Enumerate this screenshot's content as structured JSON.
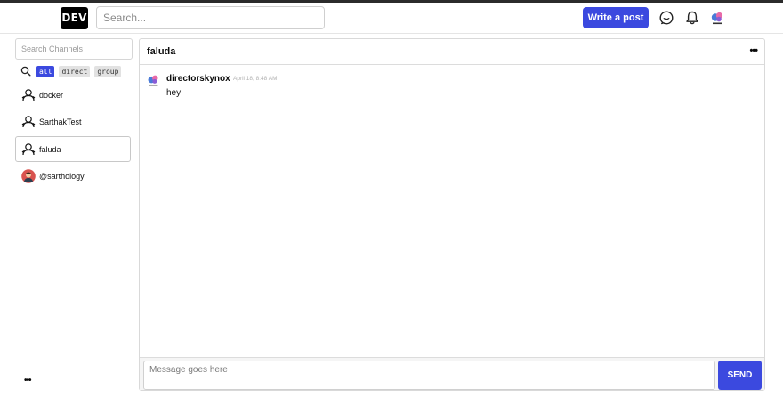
{
  "header": {
    "logo": "DEV",
    "search_placeholder": "Search...",
    "write_post_label": "Write a post",
    "icons": [
      "chat-icon",
      "bell-icon",
      "user-avatar"
    ]
  },
  "sidebar": {
    "search_placeholder": "Search Channels",
    "filters": [
      {
        "label": "all",
        "active": true
      },
      {
        "label": "direct",
        "active": false
      },
      {
        "label": "group",
        "active": false
      }
    ],
    "channels": [
      {
        "label": "docker",
        "icon": "group-channel-icon",
        "selected": false
      },
      {
        "label": "SarthakTest",
        "icon": "group-channel-icon",
        "selected": false
      },
      {
        "label": "faluda",
        "icon": "group-channel-icon",
        "selected": true
      },
      {
        "label": "@sarthology",
        "icon": "user-avatar",
        "selected": false
      }
    ],
    "more_label": "•••"
  },
  "chat": {
    "title": "faluda",
    "menu_label": "•••",
    "messages": [
      {
        "author": "directorskynox",
        "time": "April 18, 8:48 AM",
        "text": "hey"
      }
    ],
    "input_placeholder": "Message goes here",
    "send_label": "SEND"
  },
  "colors": {
    "accent": "#3b49df",
    "border": "#d9d9d9"
  }
}
